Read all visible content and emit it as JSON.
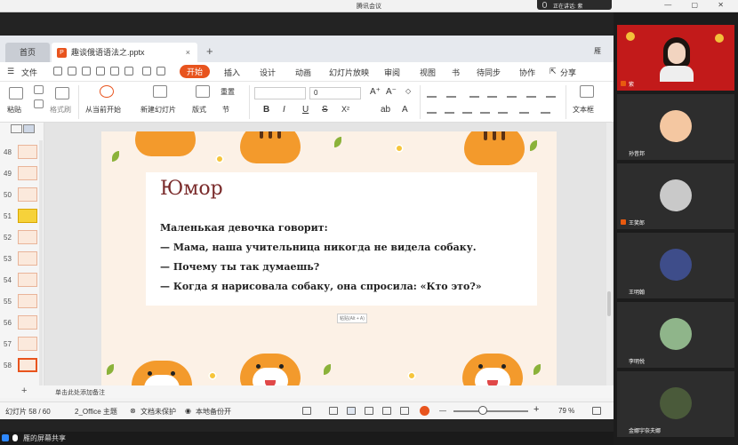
{
  "meeting": {
    "title": "腾讯会议",
    "speaking_label": "正在讲话: 紫",
    "window_controls": "— ▢ ✕"
  },
  "wps": {
    "tab_home": "首页",
    "tab_doc": "趣谈俄语语法之.pptx",
    "tab_close": "×",
    "tab_add": "+",
    "tab_right": "雁",
    "menu": {
      "file": "文件",
      "start": "开始",
      "insert": "插入",
      "design": "设计",
      "animation": "动画",
      "slideshow": "幻灯片放映",
      "review": "审阅",
      "view": "视图",
      "more": "书",
      "sync": "待同步",
      "collab": "协作",
      "share": "分享"
    },
    "ribbon": {
      "paste": "粘贴",
      "format_painter": "格式刷",
      "from_current": "从当前开始",
      "new_slide": "新建幻灯片",
      "layout": "版式",
      "section": "节",
      "reset": "重置",
      "font_size": "0",
      "text_box": "文本框"
    },
    "thumbnails": [
      {
        "num": "48",
        "style": "normal"
      },
      {
        "num": "49",
        "style": "normal"
      },
      {
        "num": "50",
        "style": "normal"
      },
      {
        "num": "51",
        "style": "yellow"
      },
      {
        "num": "52",
        "style": "normal"
      },
      {
        "num": "53",
        "style": "normal"
      },
      {
        "num": "54",
        "style": "normal"
      },
      {
        "num": "55",
        "style": "normal"
      },
      {
        "num": "56",
        "style": "normal"
      },
      {
        "num": "57",
        "style": "normal"
      },
      {
        "num": "58",
        "style": "selected"
      }
    ],
    "slide": {
      "title": "Юмор",
      "lines": [
        "Маленькая девочка говорит:",
        "— Мама, наша учительница никогда не видела собаку.",
        "— Почему ты так думаешь?",
        "— Когда я нарисовала собаку, она спросила: «Кто это?»"
      ],
      "paste_tip": "粘贴(Alt + A)"
    },
    "notes_placeholder": "单击此处添加备注",
    "status": {
      "slide_counter": "幻灯片 58 / 60",
      "theme": "2_Office 主题",
      "protect": "文档未保护",
      "backup": "本地备份开",
      "zoom": "79 %",
      "zoom_minus": "—",
      "zoom_plus": "+"
    }
  },
  "share_bar": {
    "label": "雁的屏幕共享"
  },
  "participants": [
    {
      "name": "紫",
      "type": "camera"
    },
    {
      "name": "孙昔邦",
      "type": "avatar",
      "avatar_color": "#f4c7a1"
    },
    {
      "name": "王笑郎",
      "type": "avatar",
      "avatar_color": "#c9c9c9"
    },
    {
      "name": "王明翰",
      "type": "avatar",
      "avatar_color": "#3e4d8a"
    },
    {
      "name": "李明悦",
      "type": "avatar",
      "avatar_color": "#8fb58a"
    },
    {
      "name": "金娜宇奈夫娜",
      "type": "avatar",
      "avatar_color": "#4a5a3a"
    }
  ],
  "colors": {
    "accent": "#e8541e",
    "slide_bg": "#fcf1e6",
    "title_color": "#7a2b2b",
    "tiger_orange": "#f39a2c"
  }
}
